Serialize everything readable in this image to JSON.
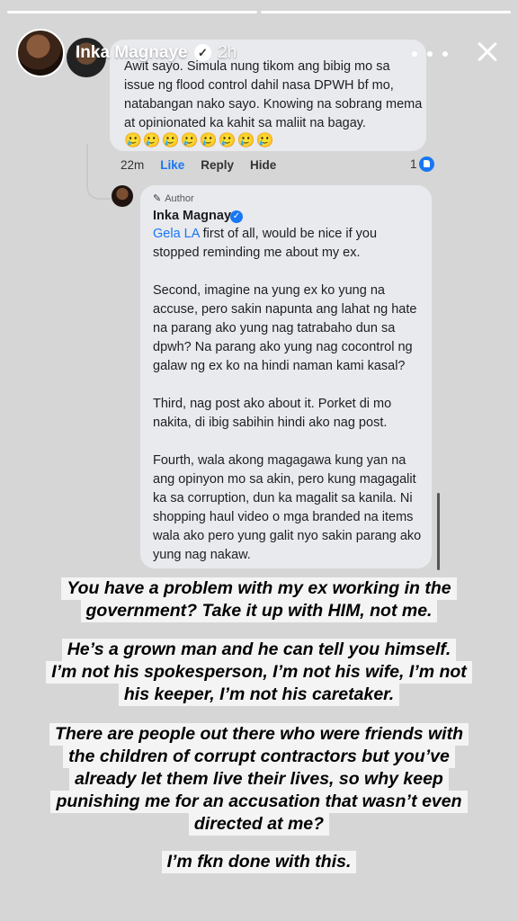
{
  "story": {
    "username": "Inka Magnaye",
    "time": "2h",
    "progress": {
      "total": 2,
      "current": 1
    }
  },
  "comment": {
    "text": "Awit sayo. Simula nung tikom ang bibig mo sa issue ng flood control dahil nasa DPWH bf mo, natabangan nako sayo. Knowing na sobrang mema at opinionated ka kahit sa maliit na bagay.",
    "emojis": "🥲🥲🥲🥲🥲🥲🥲🥲",
    "time": "22m",
    "like_label": "Like",
    "reply_label": "Reply",
    "hide_label": "Hide",
    "like_count": "1"
  },
  "reply": {
    "badge": "Author",
    "name": "Inka Magnaye",
    "mention": "Gela LA",
    "p1_rest": " first of all, would be nice if you stopped reminding me about my ex.",
    "p2": "Second, imagine na yung ex ko yung na accuse, pero sakin napunta ang lahat ng hate na parang ako yung nag tatrabaho dun sa dpwh? Na parang ako yung nag cocontrol ng galaw ng ex ko na hindi naman kami kasal?",
    "p3": "Third, nag post ako about it. Porket di mo nakita, di ibig sabihin hindi ako nag post.",
    "p4": "Fourth, wala akong magagawa kung yan na ang opinyon mo sa akin, pero kung magagalit ka sa corruption, dun ka magalit sa kanila. Ni shopping haul video o mga branded na items wala ako pero yung galit nyo sakin parang ako yung nag nakaw."
  },
  "captions": {
    "c1": [
      "You have a problem with my ex working in the",
      "government? Take it up with HIM, not me."
    ],
    "c2": [
      "He’s a grown man and he can tell you himself.",
      "I’m not his spokesperson, I’m not his wife, I’m not",
      "his keeper, I’m not his caretaker."
    ],
    "c3": [
      "There are people out there who were friends with",
      "the children of corrupt contractors but you’ve",
      "already let them live their lives, so why keep",
      "punishing me for an accusation that wasn’t even",
      "directed at me?"
    ],
    "c4": [
      "I’m fkn done with this."
    ]
  }
}
